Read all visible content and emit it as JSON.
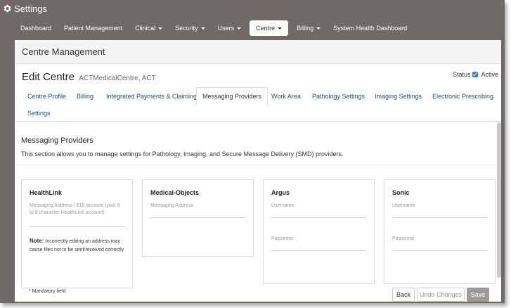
{
  "window": {
    "title": "Settings",
    "icon": "gear-icon"
  },
  "nav": {
    "items": [
      {
        "label": "Dashboard",
        "dropdown": false
      },
      {
        "label": "Patient Management",
        "dropdown": false
      },
      {
        "label": "Clinical",
        "dropdown": true
      },
      {
        "label": "Security",
        "dropdown": true
      },
      {
        "label": "Users",
        "dropdown": true
      },
      {
        "label": "Centre",
        "dropdown": true,
        "active": true
      },
      {
        "label": "Billing",
        "dropdown": true
      },
      {
        "label": "System Health Dashboard",
        "dropdown": false
      }
    ]
  },
  "panel": {
    "header": "Centre Management",
    "edit_title": "Edit Centre",
    "edit_subtitle": "ACTMedicalCentre, ACT",
    "status_label": "Status",
    "status_checked": true,
    "status_value": "Active"
  },
  "tabs": [
    {
      "label": "Centre Profile"
    },
    {
      "label": "Billing"
    },
    {
      "label": "Integrated Payments & Claiming"
    },
    {
      "label": "Messaging Providers",
      "active": true
    },
    {
      "label": "Work Area"
    },
    {
      "label": "Pathology Settings"
    },
    {
      "label": "Imaging Settings"
    },
    {
      "label": "Electronic Prescribing"
    },
    {
      "label": "Settings"
    }
  ],
  "section": {
    "title": "Messaging Providers",
    "description": "This section allows you to manage settings for Pathology, Imaging, and Secure Message Delivery (SMD) providers."
  },
  "providers": {
    "healthlink": {
      "title": "HealthLink",
      "field_label": "Messaging Address / EDI account (your 6 to 8 character HealthLink account)",
      "field_value": "",
      "note_label": "Note:",
      "note_text": "Incorrectly editing an address may cause files not to be sent/received correctly"
    },
    "medical_objects": {
      "title": "Medical-Objects",
      "field_label": "Messaging Address",
      "field_value": ""
    },
    "argus": {
      "title": "Argus",
      "username_label": "Username",
      "password_label": "Password"
    },
    "sonic": {
      "title": "Sonic",
      "username_label": "Username",
      "password_label": "Password"
    }
  },
  "footer": {
    "mandatory": "* Mandatory field",
    "back": "Back",
    "undo": "Undo Changes",
    "save": "Save"
  }
}
